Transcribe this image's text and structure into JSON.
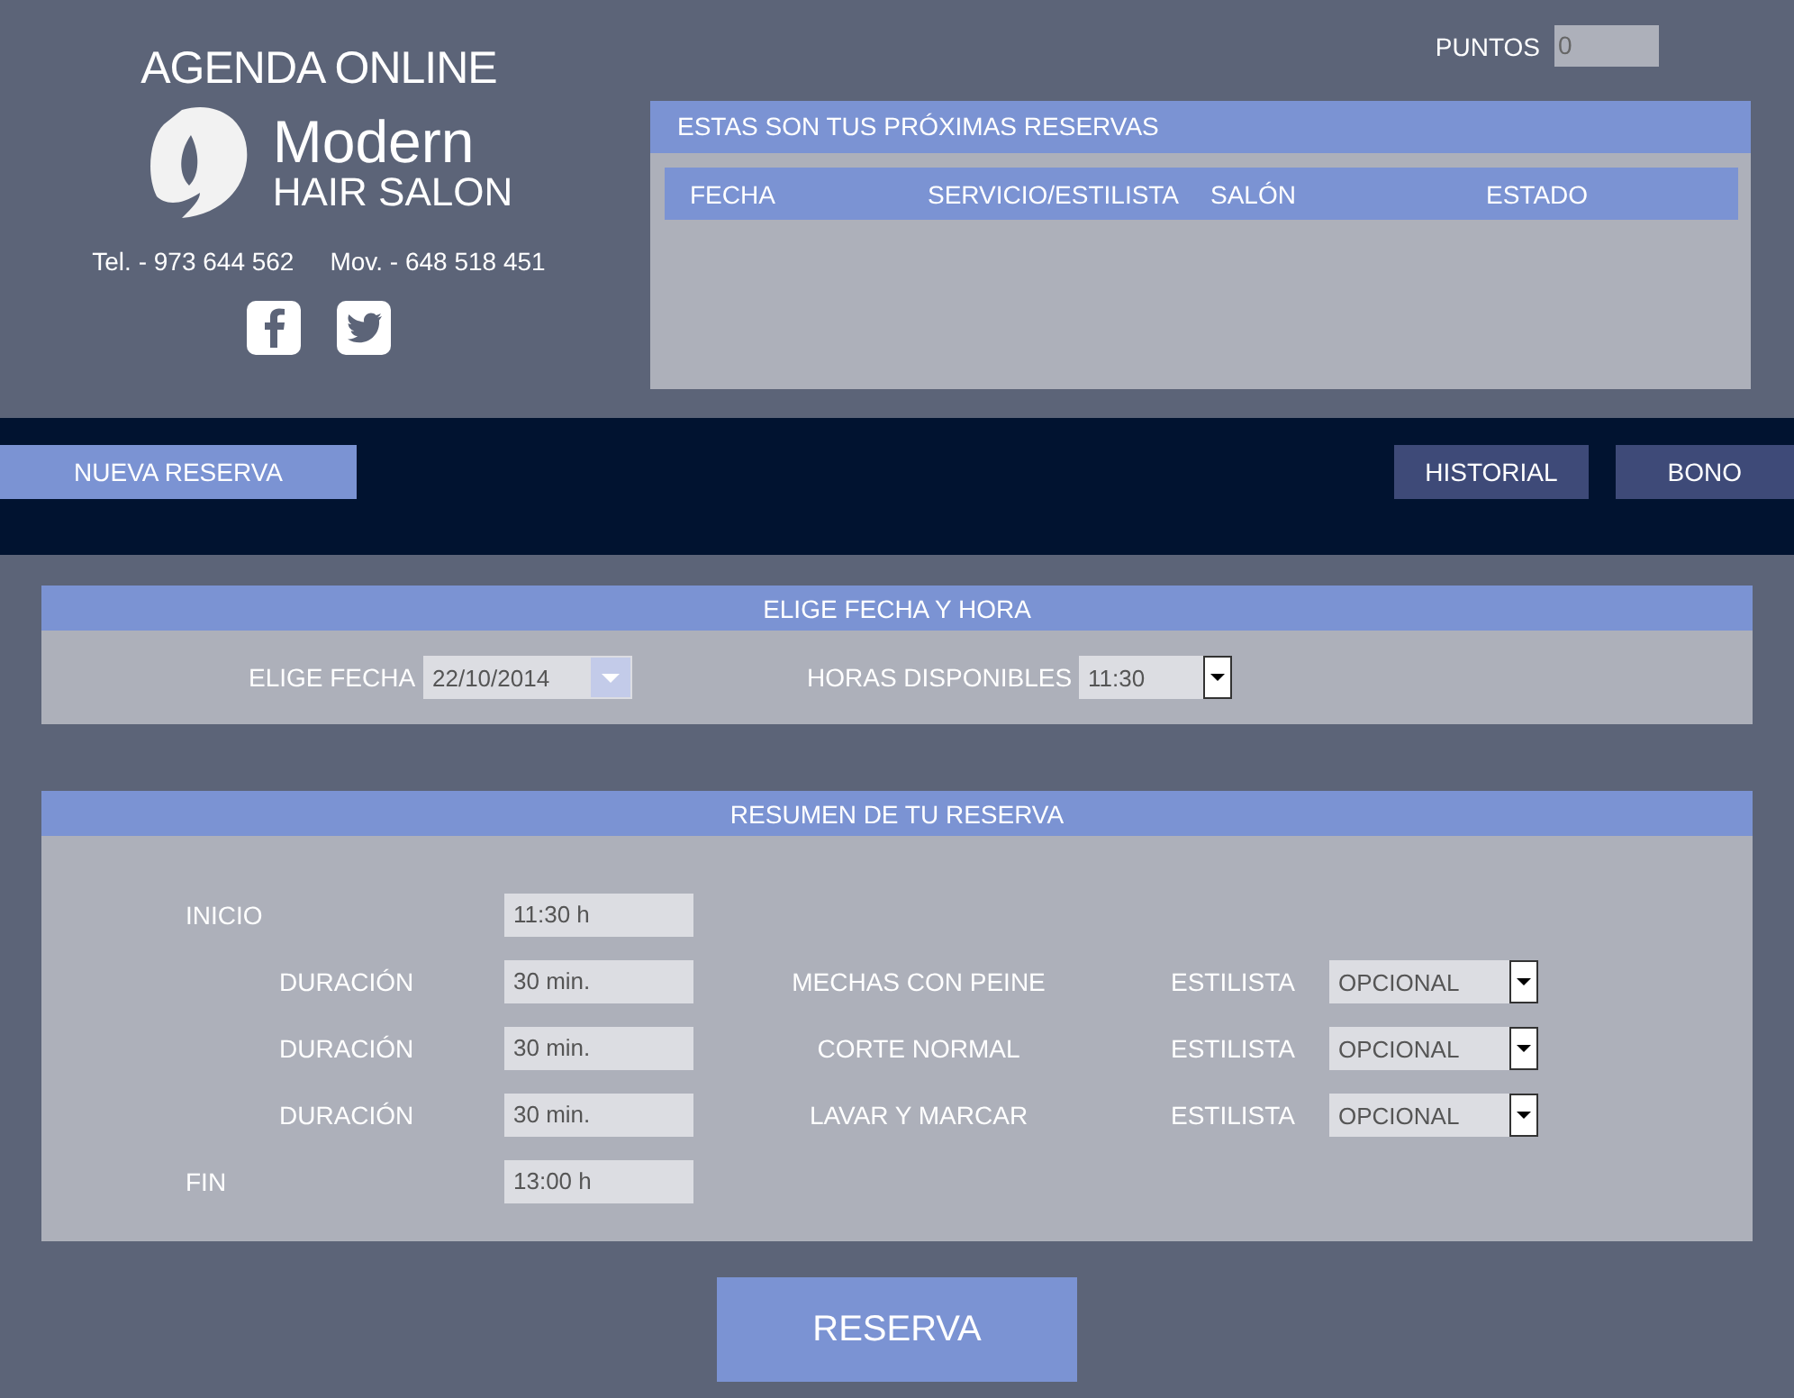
{
  "header": {
    "title": "AGENDA ONLINE",
    "logo_line1": "Modern",
    "logo_line2": "HAIR SALON",
    "phone": "Tel. - 973 644 562",
    "mobile": "Mov. - 648 518 451"
  },
  "points": {
    "label": "PUNTOS",
    "value": "0"
  },
  "upcoming": {
    "title": "ESTAS SON TUS PRÓXIMAS RESERVAS",
    "columns": [
      "FECHA",
      "SERVICIO/ESTILISTA",
      "SALÓN",
      "ESTADO"
    ]
  },
  "tabs": [
    {
      "label": "NUEVA RESERVA",
      "selected": true
    },
    {
      "label": "HISTORIAL",
      "selected": false
    },
    {
      "label": "BONO",
      "selected": false
    }
  ],
  "date_section": {
    "title": "ELIGE FECHA Y HORA",
    "date_label": "ELIGE FECHA",
    "date_value": "22/10/2014",
    "hours_label": "HORAS DISPONIBLES",
    "hours_value": "11:30"
  },
  "summary": {
    "title": "RESUMEN DE TU RESERVA",
    "rows": [
      {
        "kind": "start",
        "label": "INICIO",
        "value": "11:30 h"
      },
      {
        "kind": "service",
        "label": "DURACIÓN",
        "value": "30 min.",
        "service": "MECHAS CON PEINE",
        "stylist_label": "ESTILISTA",
        "stylist": "OPCIONAL"
      },
      {
        "kind": "service",
        "label": "DURACIÓN",
        "value": "30 min.",
        "service": "CORTE NORMAL",
        "stylist_label": "ESTILISTA",
        "stylist": "OPCIONAL"
      },
      {
        "kind": "service",
        "label": "DURACIÓN",
        "value": "30 min.",
        "service": "LAVAR Y MARCAR",
        "stylist_label": "ESTILISTA",
        "stylist": "OPCIONAL"
      },
      {
        "kind": "end",
        "label": "FIN",
        "value": "13:00 h"
      }
    ]
  },
  "submit": "RESERVA"
}
